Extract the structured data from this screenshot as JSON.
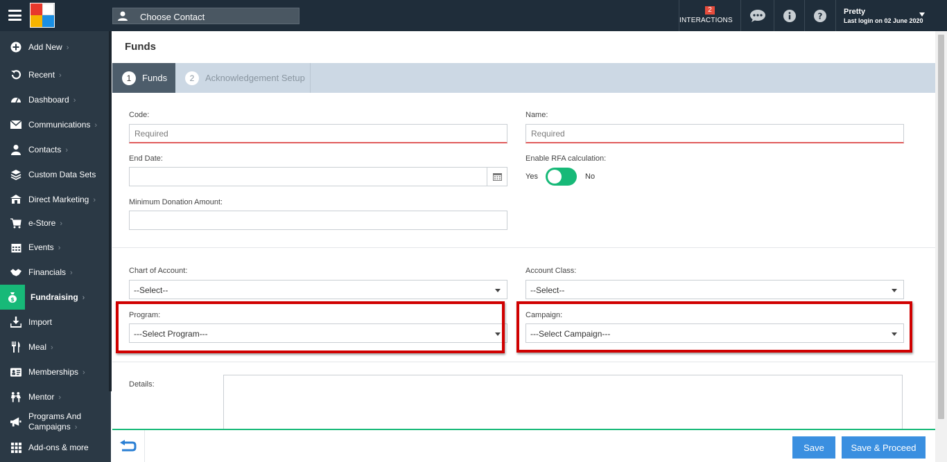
{
  "header": {
    "contact_placeholder": "Choose Contact",
    "interactions_count": "2",
    "interactions_label": "INTERACTIONS",
    "user_name": "Pretty",
    "last_login": "Last login on 02 June 2020"
  },
  "sidebar": {
    "items": [
      {
        "label": "Add New",
        "icon": "plus-circle-icon"
      },
      {
        "label": "Recent",
        "icon": "history-icon"
      },
      {
        "label": "Dashboard",
        "icon": "dashboard-icon"
      },
      {
        "label": "Communications",
        "icon": "envelope-icon"
      },
      {
        "label": "Contacts",
        "icon": "user-icon"
      },
      {
        "label": "Custom Data Sets",
        "icon": "stack-icon"
      },
      {
        "label": "Direct Marketing",
        "icon": "bank-icon"
      },
      {
        "label": "e-Store",
        "icon": "cart-icon"
      },
      {
        "label": "Events",
        "icon": "calendar-icon"
      },
      {
        "label": "Financials",
        "icon": "handshake-icon"
      },
      {
        "label": "Fundraising",
        "icon": "money-bag-icon"
      },
      {
        "label": "Import",
        "icon": "import-icon"
      },
      {
        "label": "Meal",
        "icon": "cutlery-icon"
      },
      {
        "label": "Memberships",
        "icon": "id-card-icon"
      },
      {
        "label": "Mentor",
        "icon": "mentor-icon"
      },
      {
        "label": "Programs And Campaigns",
        "icon": "megaphone-icon"
      },
      {
        "label": "Add-ons & more",
        "icon": "grid-icon"
      }
    ],
    "active": "Fundraising",
    "chevron": "›"
  },
  "page": {
    "title": "Funds",
    "steps": [
      {
        "num": "1",
        "label": "Funds"
      },
      {
        "num": "2",
        "label": "Acknowledgement Setup"
      }
    ]
  },
  "form": {
    "code_label": "Code:",
    "code_placeholder": "Required",
    "name_label": "Name:",
    "name_placeholder": "Required",
    "end_date_label": "End Date:",
    "rfa_label": "Enable RFA calculation:",
    "rfa_yes": "Yes",
    "rfa_no": "No",
    "min_donation_label": "Minimum Donation Amount:",
    "chart_label": "Chart of Account:",
    "chart_value": "--Select--",
    "account_class_label": "Account Class:",
    "account_class_value": "--Select--",
    "program_label": "Program:",
    "program_value": "---Select Program---",
    "campaign_label": "Campaign:",
    "campaign_value": "---Select Campaign---",
    "details_label": "Details:"
  },
  "footer": {
    "save_label": "Save",
    "save_proceed_label": "Save & Proceed"
  },
  "colors": {
    "accent_green": "#17b978",
    "button_blue": "#3a8fe0",
    "highlight_red": "#d00000",
    "sidebar_bg": "#2b3945"
  }
}
